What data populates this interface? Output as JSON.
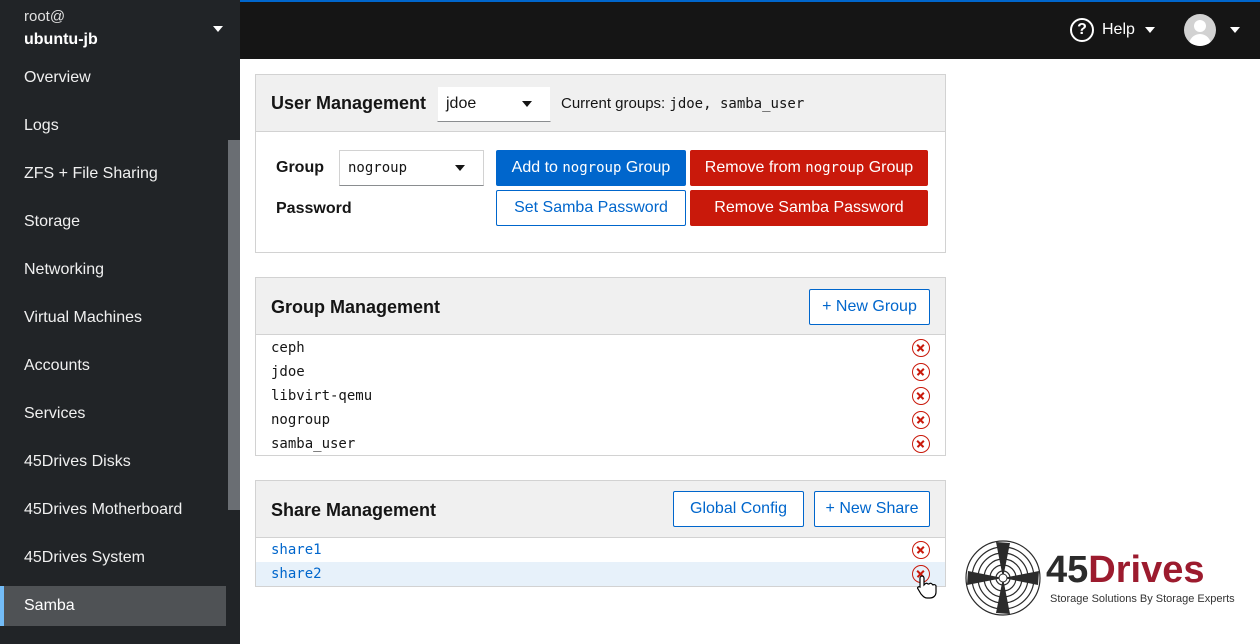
{
  "host": {
    "user": "root@",
    "name": "ubuntu-jb"
  },
  "nav": {
    "items": [
      {
        "label": "Overview"
      },
      {
        "label": "Logs"
      },
      {
        "label": "ZFS + File Sharing"
      },
      {
        "label": "Storage"
      },
      {
        "label": "Networking"
      },
      {
        "label": "Virtual Machines"
      },
      {
        "label": "Accounts"
      },
      {
        "label": "Services"
      },
      {
        "label": "45Drives Disks"
      },
      {
        "label": "45Drives Motherboard"
      },
      {
        "label": "45Drives System"
      },
      {
        "label": "Samba"
      }
    ],
    "active": "Samba"
  },
  "topbar": {
    "help_label": "Help",
    "help_icon": "question-circle-icon",
    "user_icon": "avatar-icon"
  },
  "user_mgmt": {
    "title": "User Management",
    "selected_user": "jdoe",
    "groups_prefix": "Current groups:",
    "groups_value": "jdoe, samba_user",
    "group_label": "Group",
    "selected_group": "nogroup",
    "password_label": "Password",
    "add_pre": "Add to ",
    "add_post": " Group",
    "remove_pre": "Remove from ",
    "remove_post": " Group",
    "set_password": "Set Samba Password",
    "remove_password": "Remove Samba Password"
  },
  "group_mgmt": {
    "title": "Group Management",
    "new_button": "+ New Group",
    "groups": [
      "ceph",
      "jdoe",
      "libvirt-qemu",
      "nogroup",
      "samba_user"
    ]
  },
  "share_mgmt": {
    "title": "Share Management",
    "global_config": "Global Config",
    "new_button": "+ New Share",
    "shares": [
      "share1",
      "share2"
    ]
  },
  "logo": {
    "brand": "45Drives",
    "tagline": "Storage Solutions By Storage Experts"
  },
  "colors": {
    "primary": "#0066cc",
    "danger": "#c9190b",
    "sidebar": "#212427",
    "topbar": "#151515",
    "brand_red": "#9c1b2e"
  }
}
